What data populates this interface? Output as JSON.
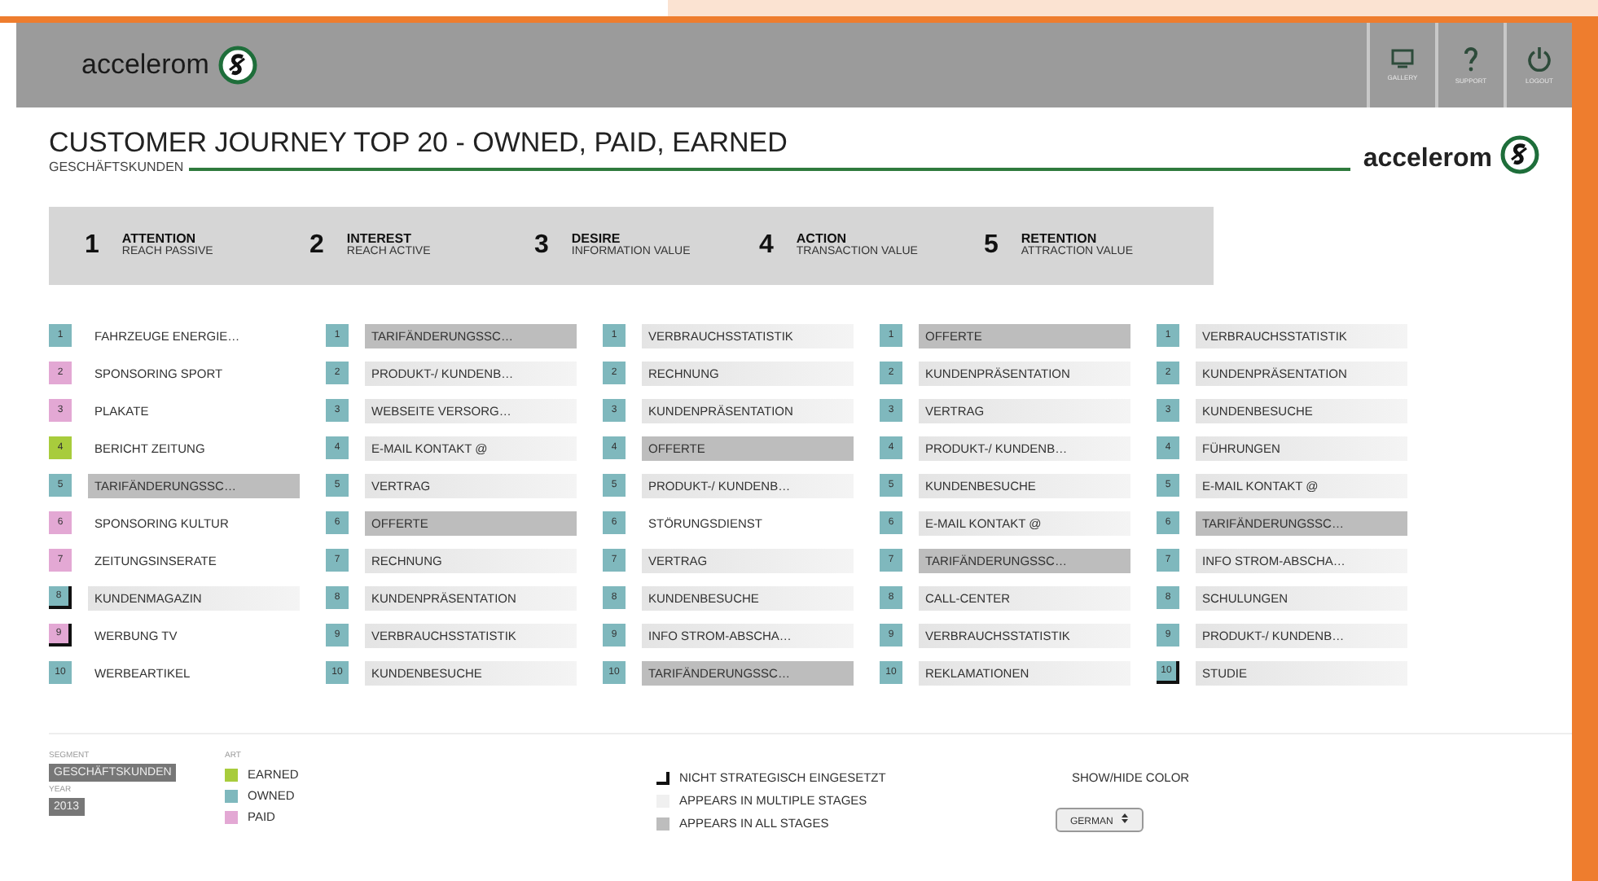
{
  "header": {
    "logo_text": "accelerom",
    "buttons": [
      {
        "kind": "gallery",
        "label": "GALLERY"
      },
      {
        "kind": "support",
        "label": "SUPPORT"
      },
      {
        "kind": "logout",
        "label": "LOGOUT"
      }
    ]
  },
  "title": "CUSTOMER JOURNEY TOP 20 - OWNED, PAID, EARNED",
  "subtitle": "GESCHÄFTSKUNDEN",
  "brand": "accelerom",
  "stages": [
    {
      "number": "1",
      "name": "ATTENTION",
      "sub": "REACH PASSIVE"
    },
    {
      "number": "2",
      "name": "INTEREST",
      "sub": "REACH ACTIVE"
    },
    {
      "number": "3",
      "name": "DESIRE",
      "sub": "INFORMATION VALUE"
    },
    {
      "number": "4",
      "name": "ACTION",
      "sub": "TRANSACTION VALUE"
    },
    {
      "number": "5",
      "name": "RETENTION",
      "sub": "ATTRACTION VALUE"
    }
  ],
  "columns": [
    [
      {
        "n": "1",
        "label": "FAHRZEUGE ENERGIE…",
        "color": "#7fb8bd",
        "multiple_stages": false,
        "all_stages": false,
        "not_strategic": false
      },
      {
        "n": "2",
        "label": "SPONSORING SPORT",
        "color": "#e3a8d4",
        "multiple_stages": false,
        "all_stages": false,
        "not_strategic": false
      },
      {
        "n": "3",
        "label": "PLAKATE",
        "color": "#e3a8d4",
        "multiple_stages": false,
        "all_stages": false,
        "not_strategic": false
      },
      {
        "n": "4",
        "label": "BERICHT ZEITUNG",
        "color": "#a8cc3c",
        "multiple_stages": false,
        "all_stages": false,
        "not_strategic": false
      },
      {
        "n": "5",
        "label": "TARIFÄNDERUNGSSC…",
        "color": "#7fb8bd",
        "multiple_stages": false,
        "all_stages": true,
        "not_strategic": false
      },
      {
        "n": "6",
        "label": "SPONSORING KULTUR",
        "color": "#e3a8d4",
        "multiple_stages": false,
        "all_stages": false,
        "not_strategic": false
      },
      {
        "n": "7",
        "label": "ZEITUNGSINSERATE",
        "color": "#e3a8d4",
        "multiple_stages": false,
        "all_stages": false,
        "not_strategic": false
      },
      {
        "n": "8",
        "label": "KUNDENMAGAZIN",
        "color": "#7fb8bd",
        "multiple_stages": true,
        "all_stages": false,
        "not_strategic": true
      },
      {
        "n": "9",
        "label": "WERBUNG TV",
        "color": "#e3a8d4",
        "multiple_stages": false,
        "all_stages": false,
        "not_strategic": true
      },
      {
        "n": "10",
        "label": "WERBEARTIKEL",
        "color": "#7fb8bd",
        "multiple_stages": false,
        "all_stages": false,
        "not_strategic": false
      }
    ],
    [
      {
        "n": "1",
        "label": "TARIFÄNDERUNGSSC…",
        "color": "#7fb8bd",
        "multiple_stages": false,
        "all_stages": true,
        "not_strategic": false
      },
      {
        "n": "2",
        "label": "PRODUKT-/ KUNDENB…",
        "color": "#7fb8bd",
        "multiple_stages": true,
        "all_stages": false,
        "not_strategic": false
      },
      {
        "n": "3",
        "label": "WEBSEITE VERSORG…",
        "color": "#7fb8bd",
        "multiple_stages": true,
        "all_stages": false,
        "not_strategic": false
      },
      {
        "n": "4",
        "label": "E-MAIL KONTAKT @",
        "color": "#7fb8bd",
        "multiple_stages": true,
        "all_stages": false,
        "not_strategic": false
      },
      {
        "n": "5",
        "label": "VERTRAG",
        "color": "#7fb8bd",
        "multiple_stages": true,
        "all_stages": false,
        "not_strategic": false
      },
      {
        "n": "6",
        "label": "OFFERTE",
        "color": "#7fb8bd",
        "multiple_stages": false,
        "all_stages": true,
        "not_strategic": false
      },
      {
        "n": "7",
        "label": "RECHNUNG",
        "color": "#7fb8bd",
        "multiple_stages": true,
        "all_stages": false,
        "not_strategic": false
      },
      {
        "n": "8",
        "label": "KUNDENPRÄSENTATION",
        "color": "#7fb8bd",
        "multiple_stages": true,
        "all_stages": false,
        "not_strategic": false
      },
      {
        "n": "9",
        "label": "VERBRAUCHSSTATISTIK",
        "color": "#7fb8bd",
        "multiple_stages": true,
        "all_stages": false,
        "not_strategic": false
      },
      {
        "n": "10",
        "label": "KUNDENBESUCHE",
        "color": "#7fb8bd",
        "multiple_stages": true,
        "all_stages": false,
        "not_strategic": false
      }
    ],
    [
      {
        "n": "1",
        "label": "VERBRAUCHSSTATISTIK",
        "color": "#7fb8bd",
        "multiple_stages": true,
        "all_stages": false,
        "not_strategic": false
      },
      {
        "n": "2",
        "label": "RECHNUNG",
        "color": "#7fb8bd",
        "multiple_stages": true,
        "all_stages": false,
        "not_strategic": false
      },
      {
        "n": "3",
        "label": "KUNDENPRÄSENTATION",
        "color": "#7fb8bd",
        "multiple_stages": true,
        "all_stages": false,
        "not_strategic": false
      },
      {
        "n": "4",
        "label": "OFFERTE",
        "color": "#7fb8bd",
        "multiple_stages": false,
        "all_stages": true,
        "not_strategic": false
      },
      {
        "n": "5",
        "label": "PRODUKT-/ KUNDENB…",
        "color": "#7fb8bd",
        "multiple_stages": true,
        "all_stages": false,
        "not_strategic": false
      },
      {
        "n": "6",
        "label": "STÖRUNGSDIENST",
        "color": "#7fb8bd",
        "multiple_stages": false,
        "all_stages": false,
        "not_strategic": false
      },
      {
        "n": "7",
        "label": "VERTRAG",
        "color": "#7fb8bd",
        "multiple_stages": true,
        "all_stages": false,
        "not_strategic": false
      },
      {
        "n": "8",
        "label": "KUNDENBESUCHE",
        "color": "#7fb8bd",
        "multiple_stages": true,
        "all_stages": false,
        "not_strategic": false
      },
      {
        "n": "9",
        "label": "INFO STROM-ABSCHA…",
        "color": "#7fb8bd",
        "multiple_stages": true,
        "all_stages": false,
        "not_strategic": false
      },
      {
        "n": "10",
        "label": "TARIFÄNDERUNGSSC…",
        "color": "#7fb8bd",
        "multiple_stages": false,
        "all_stages": true,
        "not_strategic": false
      }
    ],
    [
      {
        "n": "1",
        "label": "OFFERTE",
        "color": "#7fb8bd",
        "multiple_stages": false,
        "all_stages": true,
        "not_strategic": false
      },
      {
        "n": "2",
        "label": "KUNDENPRÄSENTATION",
        "color": "#7fb8bd",
        "multiple_stages": true,
        "all_stages": false,
        "not_strategic": false
      },
      {
        "n": "3",
        "label": "VERTRAG",
        "color": "#7fb8bd",
        "multiple_stages": true,
        "all_stages": false,
        "not_strategic": false
      },
      {
        "n": "4",
        "label": "PRODUKT-/ KUNDENB…",
        "color": "#7fb8bd",
        "multiple_stages": true,
        "all_stages": false,
        "not_strategic": false
      },
      {
        "n": "5",
        "label": "KUNDENBESUCHE",
        "color": "#7fb8bd",
        "multiple_stages": true,
        "all_stages": false,
        "not_strategic": false
      },
      {
        "n": "6",
        "label": "E-MAIL KONTAKT @",
        "color": "#7fb8bd",
        "multiple_stages": true,
        "all_stages": false,
        "not_strategic": false
      },
      {
        "n": "7",
        "label": "TARIFÄNDERUNGSSC…",
        "color": "#7fb8bd",
        "multiple_stages": false,
        "all_stages": true,
        "not_strategic": false
      },
      {
        "n": "8",
        "label": "CALL-CENTER",
        "color": "#7fb8bd",
        "multiple_stages": true,
        "all_stages": false,
        "not_strategic": false
      },
      {
        "n": "9",
        "label": "VERBRAUCHSSTATISTIK",
        "color": "#7fb8bd",
        "multiple_stages": true,
        "all_stages": false,
        "not_strategic": false
      },
      {
        "n": "10",
        "label": "REKLAMATIONEN",
        "color": "#7fb8bd",
        "multiple_stages": true,
        "all_stages": false,
        "not_strategic": false
      }
    ],
    [
      {
        "n": "1",
        "label": "VERBRAUCHSSTATISTIK",
        "color": "#7fb8bd",
        "multiple_stages": true,
        "all_stages": false,
        "not_strategic": false
      },
      {
        "n": "2",
        "label": "KUNDENPRÄSENTATION",
        "color": "#7fb8bd",
        "multiple_stages": true,
        "all_stages": false,
        "not_strategic": false
      },
      {
        "n": "3",
        "label": "KUNDENBESUCHE",
        "color": "#7fb8bd",
        "multiple_stages": true,
        "all_stages": false,
        "not_strategic": false
      },
      {
        "n": "4",
        "label": "FÜHRUNGEN",
        "color": "#7fb8bd",
        "multiple_stages": true,
        "all_stages": false,
        "not_strategic": false
      },
      {
        "n": "5",
        "label": "E-MAIL KONTAKT @",
        "color": "#7fb8bd",
        "multiple_stages": true,
        "all_stages": false,
        "not_strategic": false
      },
      {
        "n": "6",
        "label": "TARIFÄNDERUNGSSC…",
        "color": "#7fb8bd",
        "multiple_stages": false,
        "all_stages": true,
        "not_strategic": false
      },
      {
        "n": "7",
        "label": "INFO STROM-ABSCHA…",
        "color": "#7fb8bd",
        "multiple_stages": true,
        "all_stages": false,
        "not_strategic": false
      },
      {
        "n": "8",
        "label": "SCHULUNGEN",
        "color": "#7fb8bd",
        "multiple_stages": true,
        "all_stages": false,
        "not_strategic": false
      },
      {
        "n": "9",
        "label": "PRODUKT-/ KUNDENB…",
        "color": "#7fb8bd",
        "multiple_stages": true,
        "all_stages": false,
        "not_strategic": false
      },
      {
        "n": "10",
        "label": "STUDIE",
        "color": "#7fb8bd",
        "multiple_stages": true,
        "all_stages": false,
        "not_strategic": true
      }
    ]
  ],
  "filters": {
    "segment_label": "SEGMENT",
    "segment": "GESCHÄFTSKUNDEN",
    "year_label": "YEAR",
    "year": "2013"
  },
  "art": {
    "label": "ART",
    "items": [
      {
        "label": "EARNED",
        "color": "#a8cc3c"
      },
      {
        "label": "OWNED",
        "color": "#7fb8bd"
      },
      {
        "label": "PAID",
        "color": "#e3a8d4"
      }
    ]
  },
  "markers": [
    {
      "kind": "not_strategic",
      "label": "NICHT STRATEGISCH EINGESETZT"
    },
    {
      "kind": "multiple",
      "label": "APPEARS IN MULTIPLE STAGES"
    },
    {
      "kind": "all",
      "label": "APPEARS IN ALL STAGES"
    }
  ],
  "show_hide": "SHOW/HIDE COLOR",
  "language": "GERMAN"
}
